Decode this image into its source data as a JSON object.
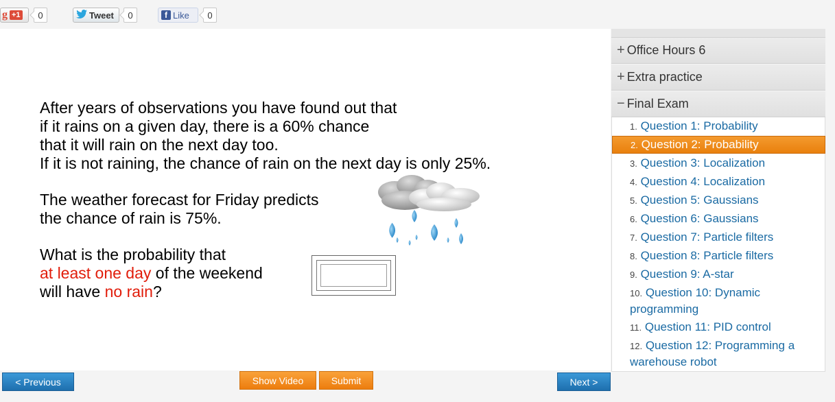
{
  "social": {
    "gplus": {
      "icon": "g",
      "label": "+1",
      "count": "0"
    },
    "twitter": {
      "label": "Tweet",
      "count": "0"
    },
    "facebook": {
      "icon": "f",
      "label": "Like",
      "count": "0"
    }
  },
  "question": {
    "p1": [
      "After years of observations you have found out that",
      "if it rains on a given day, there is a 60% chance",
      "that it will rain on the next day too.",
      "If it is not raining, the chance of rain on the next day is only 25%."
    ],
    "p2": [
      "The weather forecast for Friday predicts",
      "the chance of rain is 75%."
    ],
    "p3": {
      "line1": "What is the probability that",
      "line2_red": "at least one day",
      "line2_rest": " of the weekend",
      "line3_a": "will have ",
      "line3_red": "no rain",
      "line3_b": "?"
    },
    "answer_value": ""
  },
  "buttons": {
    "previous": "< Previous",
    "show_video": "Show Video",
    "submit": "Submit",
    "next": "Next >"
  },
  "sidebar": {
    "sections": [
      {
        "sign": "+",
        "label": "Office Hours 6"
      },
      {
        "sign": "+",
        "label": "Extra practice"
      },
      {
        "sign": "−",
        "label": "Final Exam"
      }
    ],
    "questions": [
      {
        "num": "1.",
        "label": "Question 1: Probability"
      },
      {
        "num": "2.",
        "label": "Question 2: Probability"
      },
      {
        "num": "3.",
        "label": "Question 3: Localization"
      },
      {
        "num": "4.",
        "label": "Question 4: Localization"
      },
      {
        "num": "5.",
        "label": "Question 5: Gaussians"
      },
      {
        "num": "6.",
        "label": "Question 6: Gaussians"
      },
      {
        "num": "7.",
        "label": "Question 7: Particle filters"
      },
      {
        "num": "8.",
        "label": "Question 8: Particle filters"
      },
      {
        "num": "9.",
        "label": "Question 9: A-star"
      },
      {
        "num": "10.",
        "label": "Question 10: Dynamic",
        "label2": "programming"
      },
      {
        "num": "11.",
        "label": "Question 11: PID control"
      },
      {
        "num": "12.",
        "label": "Question 12: Programming a",
        "label2": "warehouse robot"
      }
    ],
    "active_index": 1
  },
  "colors": {
    "accent_orange": "#ed7d0e",
    "link_blue": "#1a6aa3",
    "highlight_red": "#e11d0b",
    "button_blue": "#1e6fae"
  }
}
